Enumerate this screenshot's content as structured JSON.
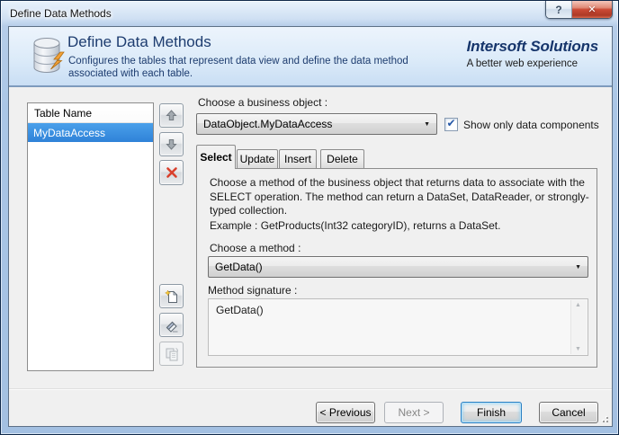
{
  "window": {
    "title": "Define Data Methods"
  },
  "titlebar_icons": {
    "help": "?",
    "close": "✕"
  },
  "header": {
    "title": "Define Data Methods",
    "description": "Configures the tables that represent data view and define the data method associated with each table.",
    "brand": "Intersoft Solutions",
    "tagline": "A better web experience"
  },
  "table_list": {
    "header": "Table Name",
    "rows": [
      {
        "name": "MyDataAccess",
        "selected": true
      }
    ]
  },
  "business_object": {
    "label": "Choose a business object :",
    "value": "DataObject.MyDataAccess",
    "checkbox_label": "Show only data components",
    "checkbox_checked": true,
    "check_glyph": "✔"
  },
  "tabs": [
    {
      "label": "Select",
      "active": true
    },
    {
      "label": "Update",
      "active": false
    },
    {
      "label": "Insert",
      "active": false
    },
    {
      "label": "Delete",
      "active": false
    }
  ],
  "select_tab": {
    "description": "Choose a method of the business object that returns data to associate with the SELECT operation. The method can return a DataSet, DataReader, or strongly-typed collection.",
    "example": "Example : GetProducts(Int32 categoryID), returns a DataSet.",
    "method_label": "Choose a method :",
    "method_value": "GetData()",
    "signature_label": "Method signature :",
    "signature_value": "GetData()"
  },
  "footer": {
    "previous_label": "< Previous",
    "next_label": "Next >",
    "next_enabled": false,
    "finish_label": "Finish",
    "cancel_label": "Cancel"
  },
  "glyphs": {
    "dropdown_arrow": "▼",
    "scroll_up": "▲",
    "scroll_down": "▼"
  },
  "colors": {
    "selection_blue": "#3587dc",
    "close_red": "#c0392b",
    "brand_navy": "#16356b",
    "header_text": "#1d3c6f",
    "header_band_border": "#7e9bbd"
  }
}
